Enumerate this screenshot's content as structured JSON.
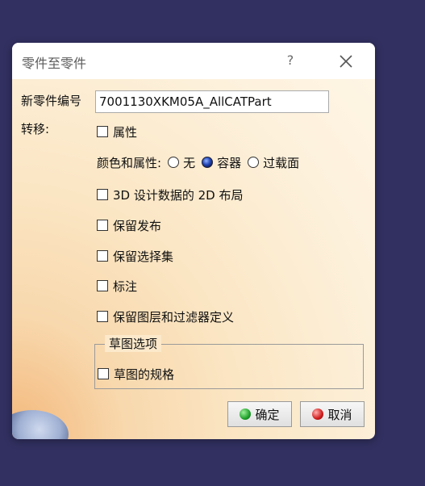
{
  "dialog": {
    "title": "零件至零件",
    "help": "?",
    "new_part_label": "新零件编号",
    "new_part_value": "7001130XKM05A_AllCATPart",
    "transfer_label": "转移:",
    "attributes_label": "属性",
    "color_props_label": "颜色和属性:",
    "radio_options": [
      {
        "label": "无",
        "selected": false
      },
      {
        "label": "容器",
        "selected": true
      },
      {
        "label": "过载面",
        "selected": false
      }
    ],
    "checkboxes": [
      {
        "label": "3D 设计数据的 2D 布局",
        "checked": false
      },
      {
        "label": "保留发布",
        "checked": false
      },
      {
        "label": "保留选择集",
        "checked": false
      },
      {
        "label": "标注",
        "checked": false
      },
      {
        "label": "保留图层和过滤器定义",
        "checked": false
      }
    ],
    "sketch_group_title": "草图选项",
    "sketch_spec_label": "草图的规格",
    "ok_label": "确定",
    "cancel_label": "取消"
  },
  "colors": {
    "background": "#313060",
    "ok_icon": "#1ea02a",
    "cancel_icon": "#d01a1a"
  }
}
